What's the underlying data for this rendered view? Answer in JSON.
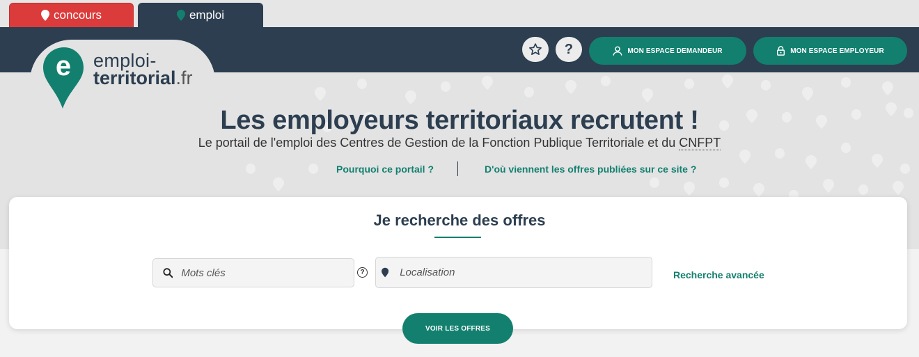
{
  "tabs": [
    {
      "label": "concours",
      "color": "#dc3b3b"
    },
    {
      "label": "emploi",
      "color": "#2c3e50"
    }
  ],
  "logo": {
    "word1": "emploi-",
    "word2": "territorial",
    "ext": ".fr",
    "letter": "e"
  },
  "header": {
    "favorites_icon": "star-icon",
    "help_label": "?",
    "btn_demandeur": "MON ESPACE DEMANDEUR",
    "btn_employeur": "MON ESPACE EMPLOYEUR"
  },
  "hero": {
    "title": "Les employeurs territoriaux recrutent !",
    "subtitle_prefix": "Le portail de l'emploi des Centres de Gestion de la Fonction Publique Territoriale et du ",
    "subtitle_abbr": "CNFPT",
    "link_why": "Pourquoi ce portail ?",
    "link_origin": "D'où viennent les offres publiées sur ce site ?"
  },
  "search": {
    "title": "Je recherche des offres",
    "keywords_placeholder": "Mots clés",
    "location_placeholder": "Localisation",
    "help_label": "?",
    "advanced_label": "Recherche avancée",
    "submit_label": "VOIR LES OFFRES"
  },
  "colors": {
    "brand_green": "#13806f",
    "navy": "#2c3e50",
    "red": "#dc3b3b"
  }
}
